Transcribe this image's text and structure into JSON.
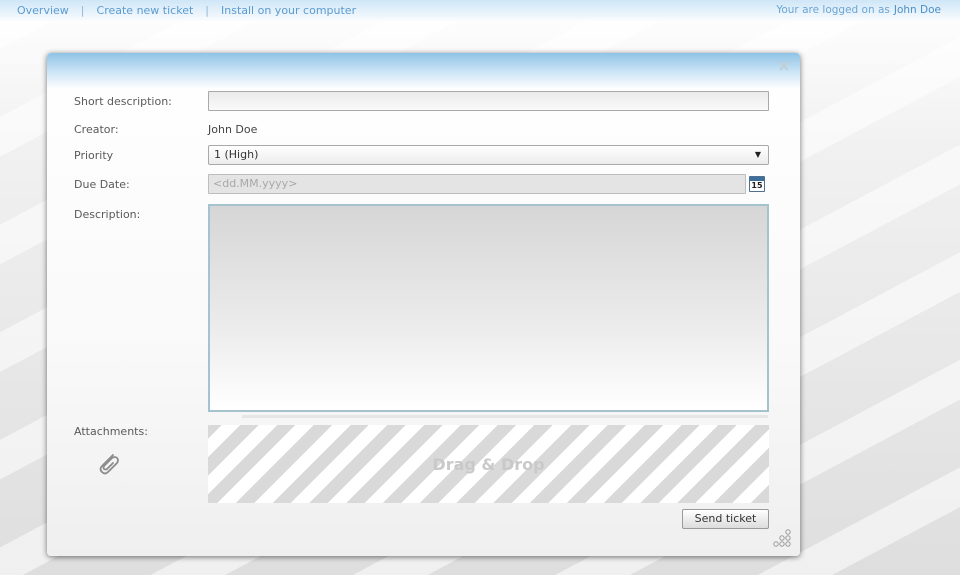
{
  "nav": {
    "items": [
      "Overview",
      "Create new ticket",
      "Install on your computer"
    ],
    "separator": "|"
  },
  "login": {
    "prefix": "Your are logged on as",
    "user": "John Doe"
  },
  "form": {
    "short_description": {
      "label": "Short description:",
      "value": ""
    },
    "creator": {
      "label": "Creator:",
      "value": "John Doe"
    },
    "priority": {
      "label": "Priority",
      "selected": "1 (High)"
    },
    "due_date": {
      "label": "Due Date:",
      "placeholder": "<dd.MM.yyyy>",
      "calendar_day": "15"
    },
    "description": {
      "label": "Description:",
      "value": ""
    },
    "attachments": {
      "label": "Attachments:",
      "drop_text": "Drag & Drop"
    },
    "send_label": "Send ticket"
  },
  "icons": {
    "close": "close-icon",
    "calendar": "calendar-icon",
    "attachment": "paperclip-icon",
    "resize": "resize-grip-icon",
    "dropdown": "chevron-down-icon"
  },
  "colors": {
    "accent": "#5b9bd0",
    "header": "#8fc3e6"
  }
}
